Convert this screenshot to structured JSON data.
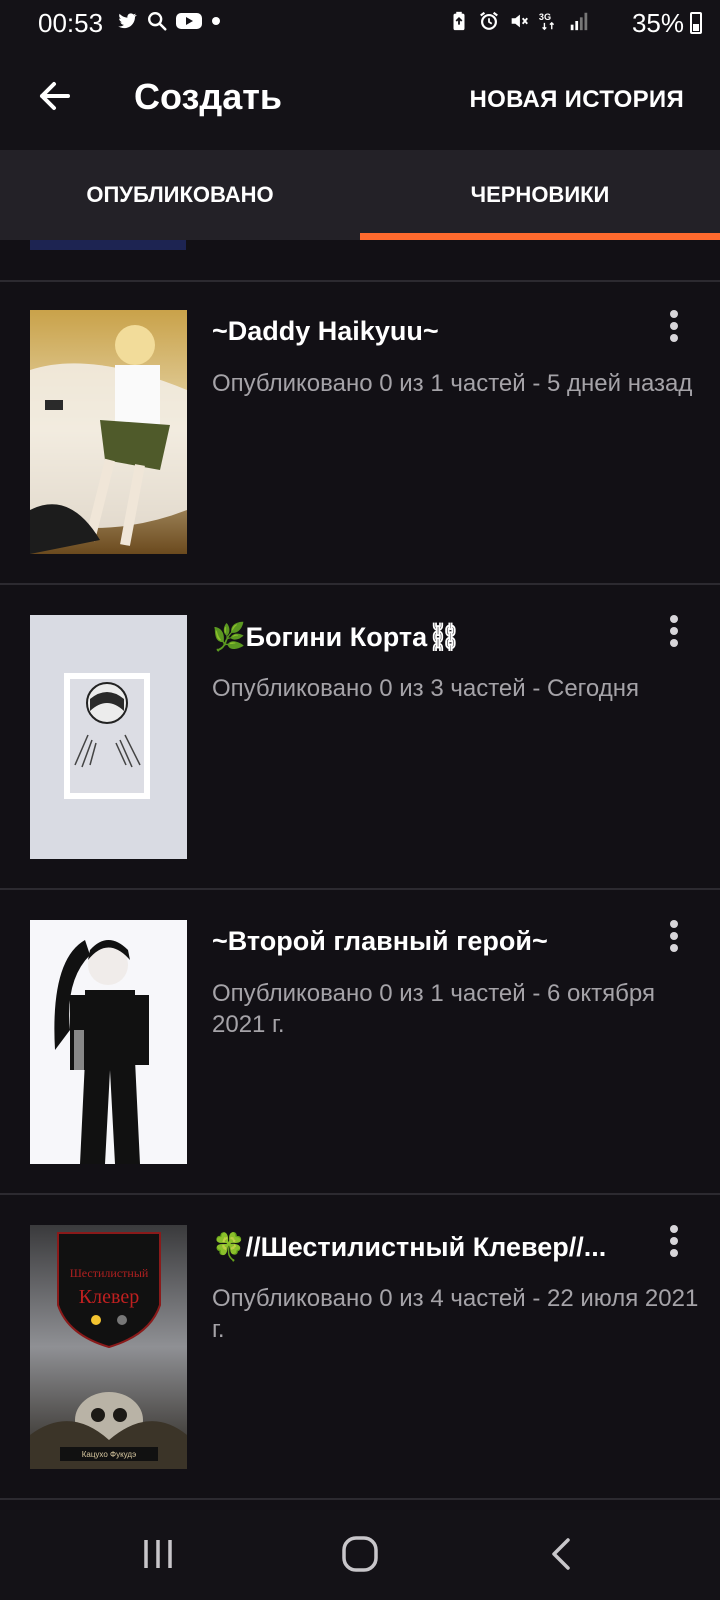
{
  "status_bar": {
    "time": "00:53",
    "battery": "35%",
    "left_icons": [
      "twitter-icon",
      "search-icon",
      "youtube-icon",
      "dot-icon"
    ],
    "right_icons": [
      "battery-saver-icon",
      "alarm-icon",
      "mute-icon",
      "3g-icon",
      "signal-icon"
    ]
  },
  "app_bar": {
    "title": "Создать",
    "new_story_label": "НОВАЯ ИСТОРИЯ"
  },
  "tabs": [
    {
      "label": "ОПУБЛИКОВАНО",
      "active": false
    },
    {
      "label": "ЧЕРНОВИКИ",
      "active": true
    }
  ],
  "stories": [
    {
      "title": "~Daddy Haikyuu~",
      "meta": "Опубликовано 0 из 1 частей - 5 дней назад"
    },
    {
      "title": "🌿Богини Корта⛓",
      "meta": "Опубликовано 0 из 3 частей - Сегодня"
    },
    {
      "title": "~Второй главный герой~",
      "meta": "Опубликовано 0 из 1 частей - 6 октября 2021 г."
    },
    {
      "title": "🍀//Шестилистный Клевер//...",
      "meta": "Опубликовано 0 из 4 частей - 22 июля 2021 г.",
      "cover_text": {
        "line1": "Шестилистный",
        "line2": "Клевер",
        "author": "Кацухо Фукудэ"
      }
    }
  ],
  "colors": {
    "accent": "#ff6a2e",
    "background": "#121015",
    "tab_bar": "#232127",
    "meta_text": "#a5a3a8"
  }
}
